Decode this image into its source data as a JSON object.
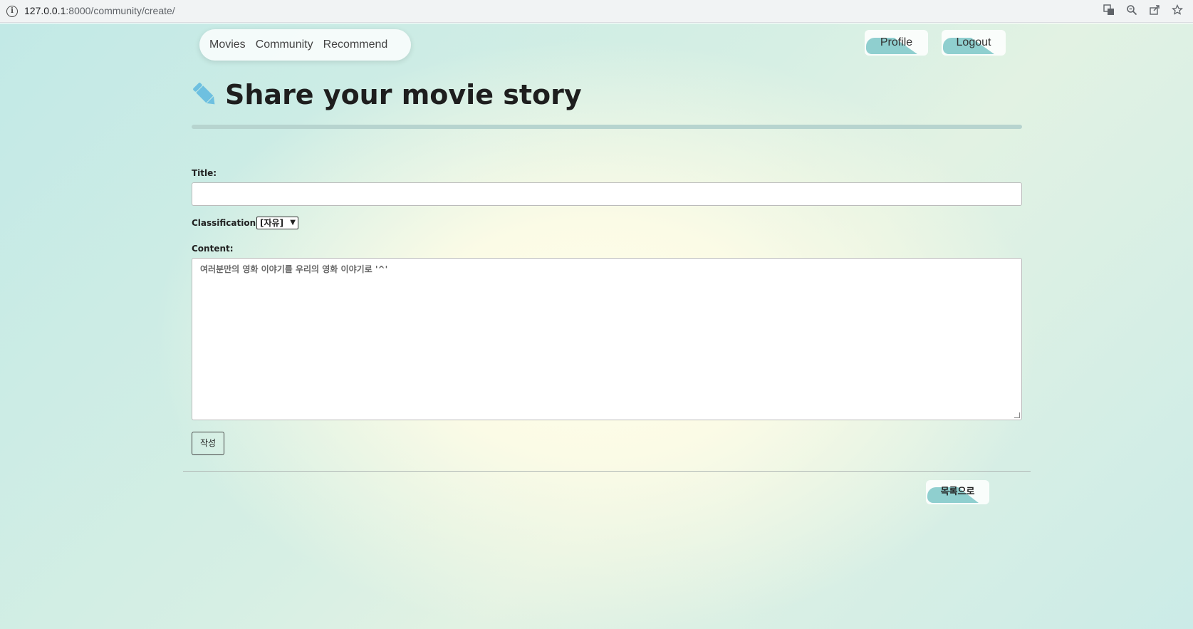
{
  "browser": {
    "url_host": "127.0.0.1",
    "url_path": ":8000/community/create/"
  },
  "nav": {
    "items": [
      "Movies",
      "Community",
      "Recommend"
    ],
    "profile_label": "Profile",
    "logout_label": "Logout"
  },
  "page": {
    "heading": "Share your movie story"
  },
  "form": {
    "title_label": "Title:",
    "title_value": "",
    "classification_label": "Classification:",
    "classification_selected": "[자유]",
    "content_label": "Content:",
    "content_placeholder": "여러분만의 영화 이야기를 우리의 영화 이야기로 '^'",
    "submit_label": "작성"
  },
  "footer": {
    "back_label": "목록으로"
  },
  "colors": {
    "accent": "#8fcfcf",
    "heading": "#1e1e1e",
    "pencil": "#6ec0e0"
  }
}
